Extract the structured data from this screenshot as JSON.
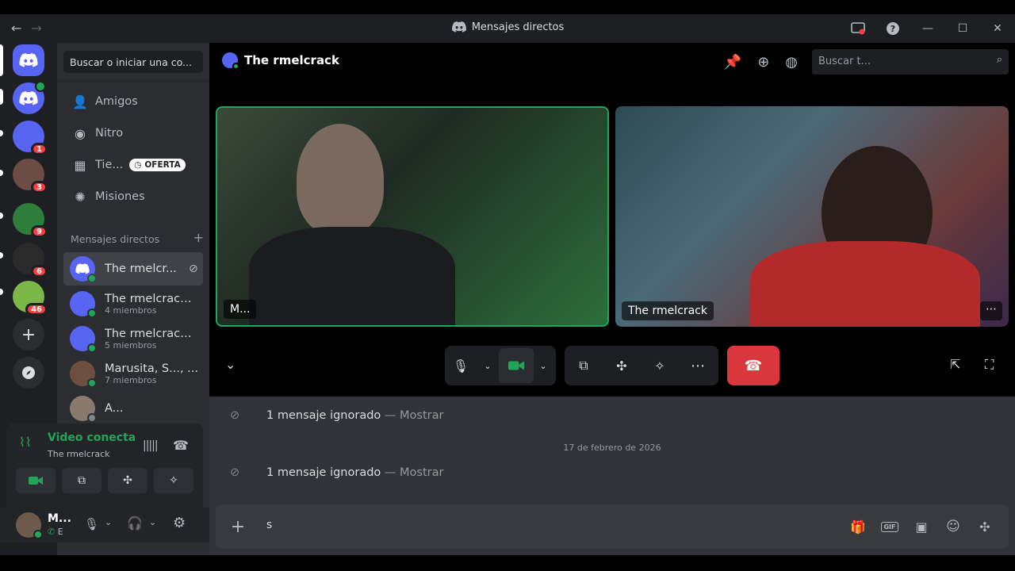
{
  "window": {
    "title": "Mensajes directos"
  },
  "sidebar": {
    "search_label": "Buscar o iniciar una co...",
    "nav": [
      {
        "label": "Amigos"
      },
      {
        "label": "Nitro"
      },
      {
        "label": "Tie...",
        "badge": "OFERTA"
      },
      {
        "label": "Misiones"
      }
    ],
    "dm_header": "Mensajes directos",
    "dms": [
      {
        "name": "The rmelcr...",
        "sub": ""
      },
      {
        "name": "The rmelcrack,...",
        "sub": "4 miembros"
      },
      {
        "name": "The rmelcrack,...",
        "sub": "5 miembros"
      },
      {
        "name": "Marusita, S..., ...",
        "sub": "7 miembros"
      },
      {
        "name": "A...",
        "sub": ""
      }
    ]
  },
  "servers": {
    "badges": [
      "1",
      "3",
      "9",
      "6",
      "46"
    ]
  },
  "voice": {
    "status": "Video conectad",
    "channel": "The rmelcrack"
  },
  "user": {
    "name": "M...",
    "status": "E"
  },
  "channel": {
    "title": "The rmelcrack",
    "search_placeholder": "Buscar t..."
  },
  "tiles": [
    {
      "label": "M..."
    },
    {
      "label": "The rmelcrack"
    }
  ],
  "messages": {
    "ignored1": "1 mensaje ignorado",
    "show1": "— Mostrar",
    "date": "17 de febrero de 2026",
    "ignored2": "1 mensaje ignorado",
    "show2": "— Mostrar"
  },
  "composer": {
    "value": "s"
  },
  "colors": {
    "accent": "#5865f2",
    "green": "#23a559",
    "danger": "#da373c"
  }
}
